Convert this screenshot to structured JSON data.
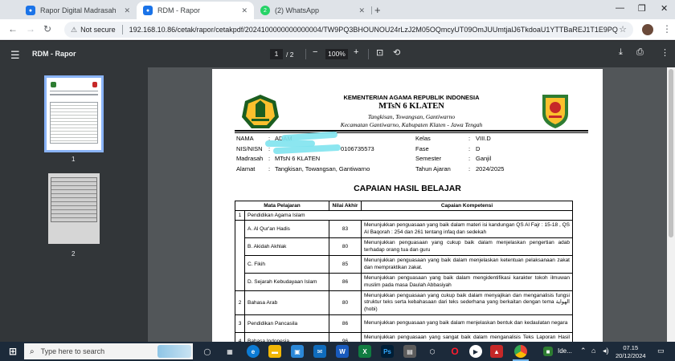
{
  "browser": {
    "tabs": [
      {
        "title": "Rapor Digital Madrasah",
        "active": false,
        "icon": "madrasah-favicon-icon",
        "color": "#1a73e8"
      },
      {
        "title": "RDM - Rapor",
        "active": true,
        "icon": "madrasah-favicon-icon",
        "color": "#1a73e8"
      },
      {
        "title": "(2) WhatsApp",
        "active": false,
        "icon": "whatsapp-icon",
        "color": "#25d366"
      }
    ],
    "new_tab_label": "+",
    "security_label": "Not secure",
    "url": "192.168.10.86/cetak/rapor/cetakpdf/2024100000000000004/TW9PQ3BHOUNOU24rLzJ2M05OQmcyUT09OmJUUmtjalJ6TkdoaU1YTTBaREJ1T1E9PQ"
  },
  "pdf_viewer": {
    "title": "RDM - Rapor",
    "current_page": "1",
    "total_pages": "/ 2",
    "zoom": "100%",
    "thumbnails": [
      {
        "num": "1"
      },
      {
        "num": "2"
      }
    ]
  },
  "report": {
    "header": {
      "ministry": "KEMENTERIAN AGAMA REPUBLIK INDONESIA",
      "school": "MTsN 6 KLATEN",
      "address1": "Tangkisan, Towangsan, Gantiwarno",
      "address2": "Kecamatan Gantiwarno, Kabupaten Klaten - Jawa Tengah"
    },
    "left_info": [
      {
        "label": "NAMA",
        "colon": ":",
        "value": "ADAM"
      },
      {
        "label": "NIS/NISN",
        "colon": ":",
        "value": "0106735573"
      },
      {
        "label": "Madrasah",
        "colon": ":",
        "value": "MTsN 6 KLATEN"
      },
      {
        "label": "Alamat",
        "colon": ":",
        "value": "Tangkisan, Towangsan, Gantiwarno"
      }
    ],
    "right_info": [
      {
        "label": "Kelas",
        "colon": ":",
        "value": "VIII.D"
      },
      {
        "label": "Fase",
        "colon": ":",
        "value": "D"
      },
      {
        "label": "Semester",
        "colon": ":",
        "value": "Ganjil"
      },
      {
        "label": "Tahun Ajaran",
        "colon": ":",
        "value": "2024/2025"
      }
    ],
    "section_title": "CAPAIAN HASIL BELAJAR",
    "table_headers": {
      "subject": "Mata Pelajaran",
      "score": "Nilai Akhir",
      "competency": "Capaian Kompetensi"
    },
    "group1": {
      "no": "1",
      "name": "Pendidikan Agama Islam"
    },
    "sub_rows": [
      {
        "subject": "A. Al Qur'an Hadis",
        "score": "83",
        "competency": "Menunjukkan penguasaan yang baik dalam materi isi kandungan QS Al Fajr : 15-18 , QS Al Baqorah : 254 dan 261 tentang infaq dan sedekah"
      },
      {
        "subject": "B. Akidah Akhlak",
        "score": "80",
        "competency": "Menunjukkan penguasaan yang cukup baik dalam menjelaskan pengertian adab terhadap orang tua dan guru"
      },
      {
        "subject": "C. Fikih",
        "score": "85",
        "competency": "Menunjukkan penguasaan yang baik dalam menjelaskan ketentuan pelaksanaan zakat dan mempraktikan zakat."
      },
      {
        "subject": "D. Sejarah Kebudayaan Islam",
        "score": "86",
        "competency": "Menunjukkan penguasaan yang baik dalam mengidentifikasi karakter tokoh ilmuwan muslim pada masa Daulah Abbasiyah"
      }
    ],
    "main_rows": [
      {
        "no": "2",
        "subject": "Bahasa Arab",
        "score": "80",
        "competency": "Menunjukkan penguasaan yang cukup baik dalam menyajikan dan menganalisis fungsi struktur teks serta kebahasaan dari teks sederhana yang berkaitan dengan tema الهواية (hobi)"
      },
      {
        "no": "3",
        "subject": "Pendidikan Pancasila",
        "score": "86",
        "competency": "Menunjukkan penguasaan yang baik dalam menjelaskan bentuk dan kedaulatan negara"
      },
      {
        "no": "4",
        "subject": "Bahasa Indonesia",
        "score": "96",
        "competency": "Menunjukkan penguasaan yang sangat baik dalam menganalisis Teks Laporan Hasil Observasi"
      }
    ]
  },
  "taskbar": {
    "search_placeholder": "Type here to search",
    "tray_app_label": "Ide...",
    "time": "07.15",
    "date": "20/12/2024"
  }
}
